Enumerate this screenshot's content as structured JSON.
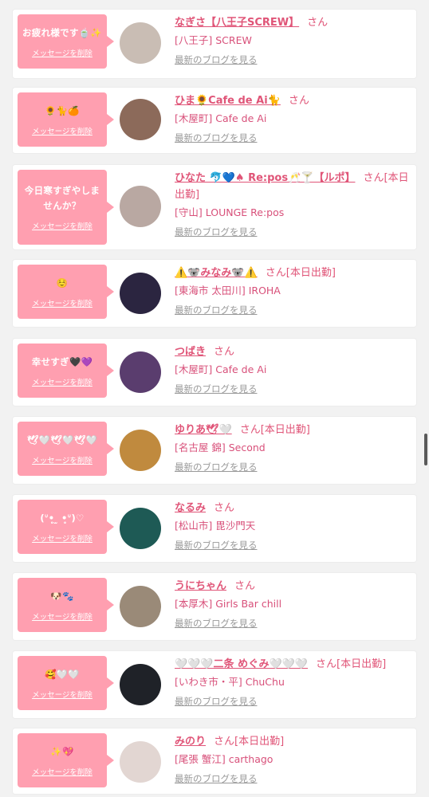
{
  "cards": [
    {
      "message": "お疲れ様です🍵✨",
      "delete_label": "メッセージを削除",
      "name": "なぎさ【八王子SCREW】",
      "suffix": "さん",
      "shop": "[八王子] SCREW",
      "blog_label": "最新のブログを見る",
      "avatar_color": "#c9bdb4"
    },
    {
      "message": "🌻🐈🍊",
      "delete_label": "メッセージを削除",
      "name": "ひま🌻Cafe de Ai🐈",
      "suffix": "さん",
      "shop": "[木屋町] Cafe de Ai",
      "blog_label": "最新のブログを見る",
      "avatar_color": "#8c6a5a"
    },
    {
      "message": "今日寒すぎやしませんか？",
      "delete_label": "メッセージを削除",
      "name": "ひなた 🐬💙♠ Re:pos🥂🍸【ルポ】",
      "suffix": "さん[本日出勤]",
      "shop": "[守山] LOUNGE Re:pos",
      "blog_label": "最新のブログを見る",
      "avatar_color": "#b9a8a2"
    },
    {
      "message": "☺️",
      "delete_label": "メッセージを削除",
      "name": "⚠️🐨みなみ🐨⚠️",
      "suffix": "さん[本日出勤]",
      "shop": "[東海市 太田川] IROHA",
      "blog_label": "最新のブログを見る",
      "avatar_color": "#2b2540"
    },
    {
      "message": "幸せすぎ🖤💜",
      "delete_label": "メッセージを削除",
      "name": "つばき",
      "suffix": "さん",
      "shop": "[木屋町] Cafe de Ai",
      "blog_label": "最新のブログを見る",
      "avatar_color": "#5a3d6e"
    },
    {
      "message": "🕊🤍🕊🤍🕊🤍",
      "delete_label": "メッセージを削除",
      "name": "ゆりあ🕊🤍",
      "suffix": "さん[本日出勤]",
      "shop": "[名古屋 錦] Second",
      "blog_label": "最新のブログを見る",
      "avatar_color": "#c08a3e"
    },
    {
      "message": "(ᐡ•̥ ̫ •̥ᐡ)♡",
      "delete_label": "メッセージを削除",
      "name": "なるみ",
      "suffix": "さん",
      "shop": "[松山市] 毘沙門天",
      "blog_label": "最新のブログを見る",
      "avatar_color": "#1e5a55"
    },
    {
      "message": "🐶🐾",
      "delete_label": "メッセージを削除",
      "name": "うにちゃん",
      "suffix": "さん",
      "shop": "[本厚木] Girls Bar chill",
      "blog_label": "最新のブログを見る",
      "avatar_color": "#9a8a78"
    },
    {
      "message": "🥰🤍🤍",
      "delete_label": "メッセージを削除",
      "name": "🤍🤍🤍二条 めぐみ🤍🤍🤍",
      "suffix": "さん[本日出勤]",
      "shop": "[いわき市・平] ChuChu",
      "blog_label": "最新のブログを見る",
      "avatar_color": "#1f2228"
    },
    {
      "message": "✨💖",
      "delete_label": "メッセージを削除",
      "name": "みのり",
      "suffix": "さん[本日出勤]",
      "shop": "[尾張 蟹江] carthago",
      "blog_label": "最新のブログを見る",
      "avatar_color": "#e2d6d2"
    }
  ]
}
